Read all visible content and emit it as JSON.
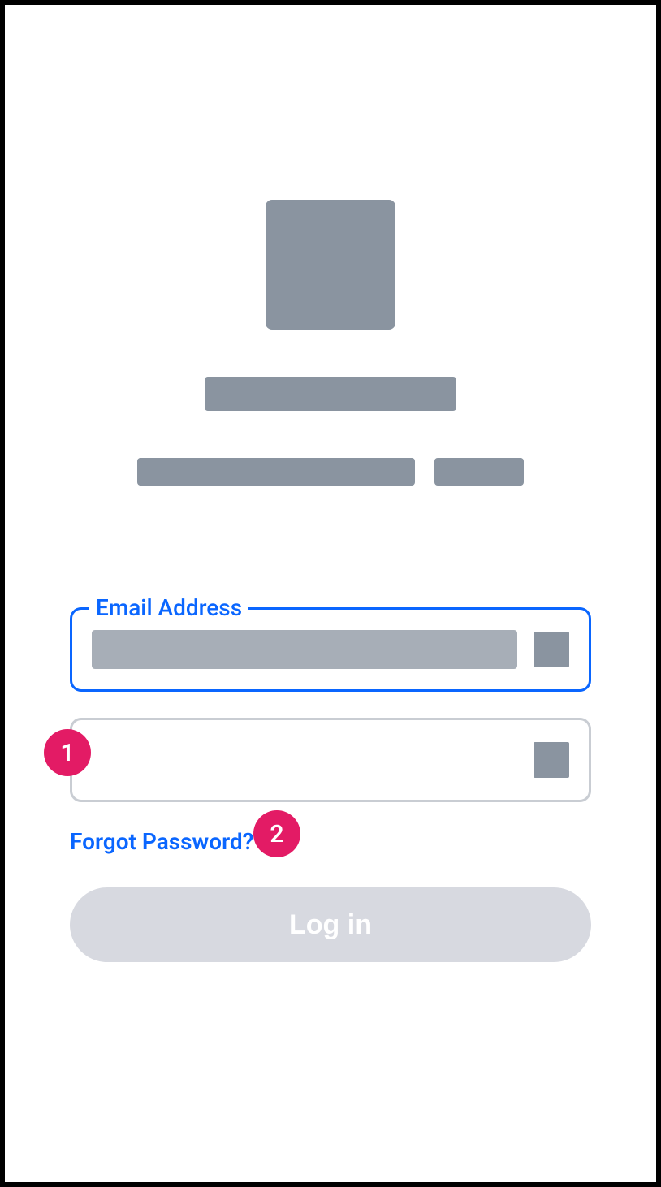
{
  "form": {
    "email": {
      "label": "Email Address"
    },
    "forgot_label": "Forgot Password?",
    "login_label": "Log in"
  },
  "callouts": {
    "one": "1",
    "two": "2"
  }
}
